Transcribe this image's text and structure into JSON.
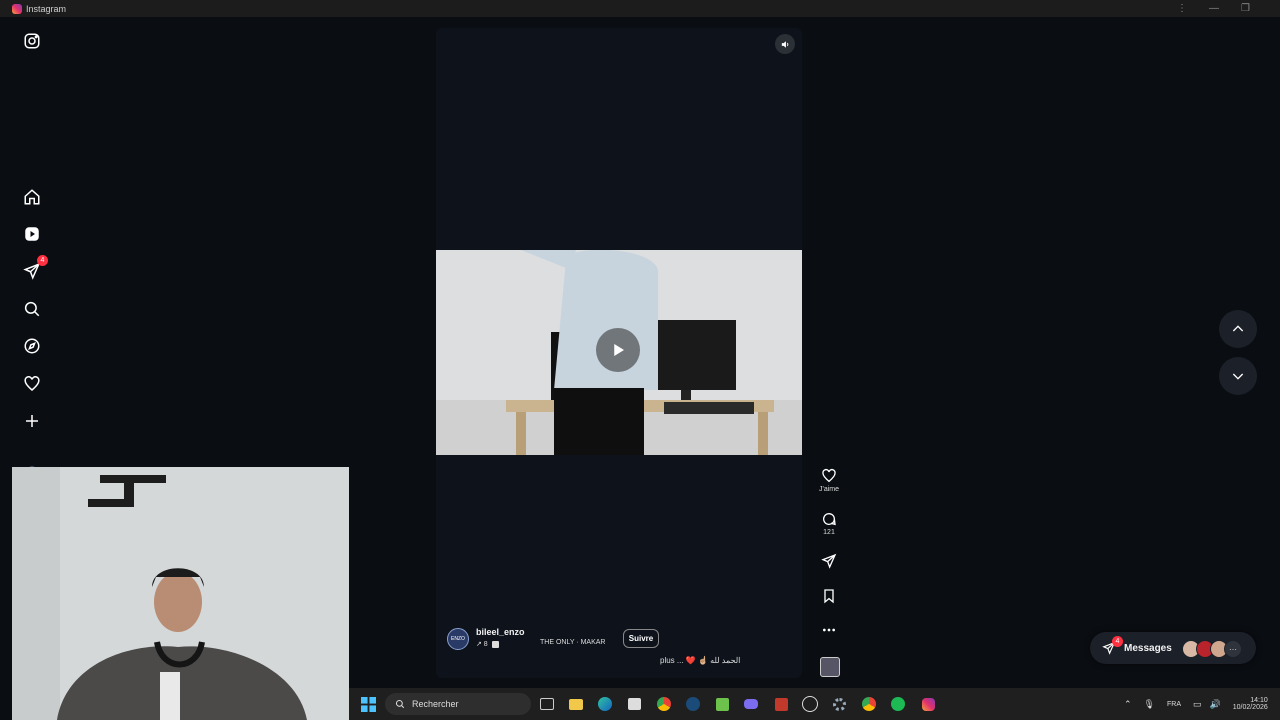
{
  "window": {
    "title": "Instagram"
  },
  "sidebar": {
    "items": [
      {
        "name": "instagram-logo-icon"
      },
      {
        "name": "home-icon"
      },
      {
        "name": "reels-icon"
      },
      {
        "name": "messages-icon",
        "badge": "4"
      },
      {
        "name": "search-icon"
      },
      {
        "name": "explore-icon"
      },
      {
        "name": "notifications-icon"
      },
      {
        "name": "create-icon"
      },
      {
        "name": "profile-avatar"
      }
    ]
  },
  "reel": {
    "username": "bileel_enzo",
    "avatar_text": "ENZO",
    "sub_label": "↗ 8",
    "audio": "THE ONLY · MAKAR",
    "follow_label": "Suivre",
    "caption": "plus ... ❤️ ☝🏼 الحمد لله"
  },
  "actions": {
    "like_label": "J'aime",
    "comments_count": "121"
  },
  "messages": {
    "label": "Messages",
    "badge": "4"
  },
  "taskbar": {
    "search_placeholder": "Rechercher",
    "lang": "FRA",
    "time": "14:10",
    "date": "10/02/2026"
  },
  "colors": {
    "background": "#0a0d12",
    "badge": "#ff3040",
    "accent": "#e1306c"
  }
}
